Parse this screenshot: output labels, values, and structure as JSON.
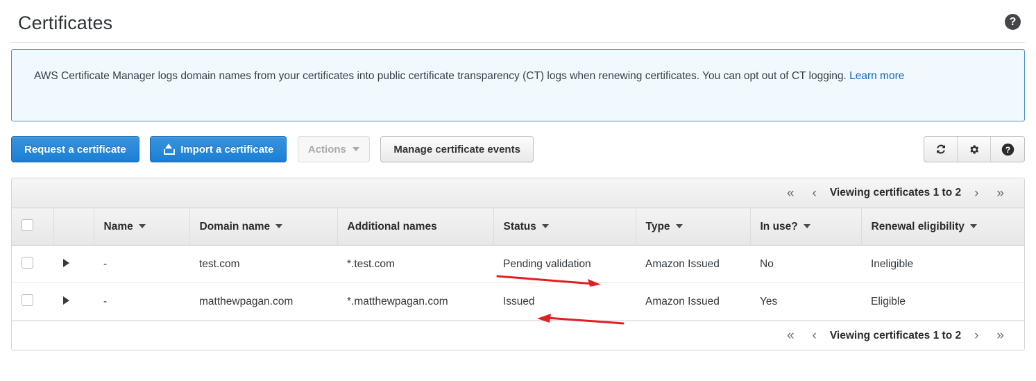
{
  "header": {
    "title": "Certificates",
    "help_icon": "help-circle-icon",
    "help_glyph": "?"
  },
  "banner": {
    "text": "AWS Certificate Manager logs domain names from your certificates into public certificate transparency (CT) logs when renewing certificates. You can opt out of CT logging. ",
    "link_text": "Learn more"
  },
  "toolbar": {
    "request_label": "Request a certificate",
    "import_label": "Import a certificate",
    "import_icon": "upload-icon",
    "actions_label": "Actions",
    "actions_caret": "chevron-down-icon",
    "manage_events_label": "Manage certificate events",
    "refresh_icon": "refresh-icon",
    "settings_icon": "gear-icon",
    "help_icon": "help-circle-icon",
    "refresh_glyph": "↻",
    "settings_glyph": "⚙",
    "help_glyph": "?"
  },
  "pagination": {
    "first_glyph": "«",
    "prev_glyph": "‹",
    "label": "Viewing certificates 1 to 2",
    "next_glyph": "›",
    "last_glyph": "»"
  },
  "table": {
    "columns": [
      {
        "key": "select",
        "label": "",
        "sortable": false
      },
      {
        "key": "expand",
        "label": "",
        "sortable": false
      },
      {
        "key": "name",
        "label": "Name",
        "sortable": true
      },
      {
        "key": "domain",
        "label": "Domain name",
        "sortable": true
      },
      {
        "key": "additional",
        "label": "Additional names",
        "sortable": false
      },
      {
        "key": "status",
        "label": "Status",
        "sortable": true
      },
      {
        "key": "type",
        "label": "Type",
        "sortable": true
      },
      {
        "key": "inuse",
        "label": "In use?",
        "sortable": true
      },
      {
        "key": "renewal",
        "label": "Renewal eligibility",
        "sortable": true
      }
    ],
    "rows": [
      {
        "name": "-",
        "domain": "test.com",
        "additional": "*.test.com",
        "status": "Pending validation",
        "status_state": "pending",
        "type": "Amazon Issued",
        "inuse": "No",
        "renewal": "Ineligible"
      },
      {
        "name": "-",
        "domain": "matthewpagan.com",
        "additional": "*.matthewpagan.com",
        "status": "Issued",
        "status_state": "issued",
        "type": "Amazon Issued",
        "inuse": "Yes",
        "renewal": "Eligible"
      }
    ]
  },
  "annotations": [
    {
      "name": "arrow-to-pending-validation",
      "color": "#e02020",
      "points_to": "Pending validation"
    },
    {
      "name": "arrow-to-issued",
      "color": "#e02020",
      "points_to": "Issued"
    }
  ],
  "colors": {
    "primary_button": "#1a7fd4",
    "banner_border": "#4a90c4",
    "banner_bg": "#f1f8fe",
    "link": "#1166bb",
    "status_pending": "#d4802a",
    "status_issued": "#2aa44f",
    "annotation_red": "#e02020"
  }
}
